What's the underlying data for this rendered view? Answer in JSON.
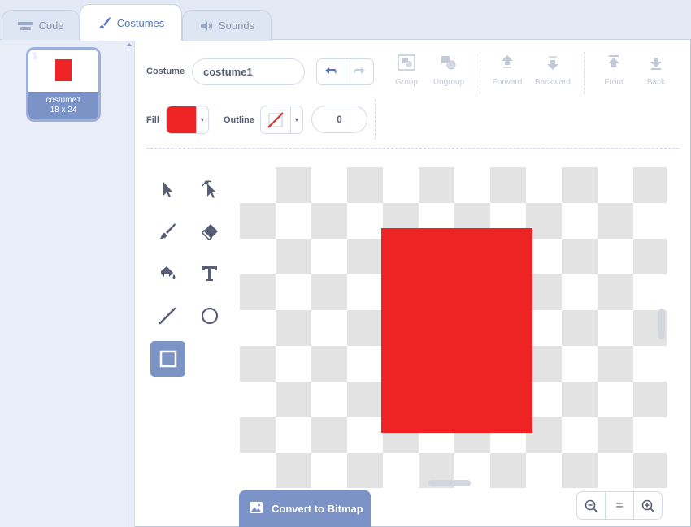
{
  "tabs": [
    {
      "label": "Code",
      "icon": "code-blocks-icon",
      "active": false
    },
    {
      "label": "Costumes",
      "icon": "paintbrush-icon",
      "active": true
    },
    {
      "label": "Sounds",
      "icon": "speaker-icon",
      "active": false
    }
  ],
  "costume_list": {
    "items": [
      {
        "index": "1",
        "name": "costume1",
        "size": "18 x 24",
        "preview_color": "#ee2424"
      }
    ]
  },
  "toolbar": {
    "costume_label": "Costume",
    "costume_name": "costume1",
    "group_label": "Group",
    "ungroup_label": "Ungroup",
    "forward_label": "Forward",
    "backward_label": "Backward",
    "front_label": "Front",
    "back_label": "Back"
  },
  "style_bar": {
    "fill_label": "Fill",
    "fill_color": "#ee2424",
    "outline_label": "Outline",
    "outline_color": "none",
    "outline_width": "0"
  },
  "tools": [
    "select-icon",
    "reshape-icon",
    "brush-icon",
    "eraser-icon",
    "fill-icon",
    "text-icon",
    "line-icon",
    "circle-icon",
    "rectangle-icon"
  ],
  "selected_tool": "rectangle-icon",
  "canvas": {
    "shape": "rectangle",
    "shape_color": "#ee2424"
  },
  "footer": {
    "convert_label": "Convert to Bitmap",
    "zoom_out": "−",
    "zoom_reset": "=",
    "zoom_in": "+"
  },
  "colors": {
    "accent": "#7b93c6",
    "active_tab_text": "#5678b8",
    "text": "#575e75"
  }
}
